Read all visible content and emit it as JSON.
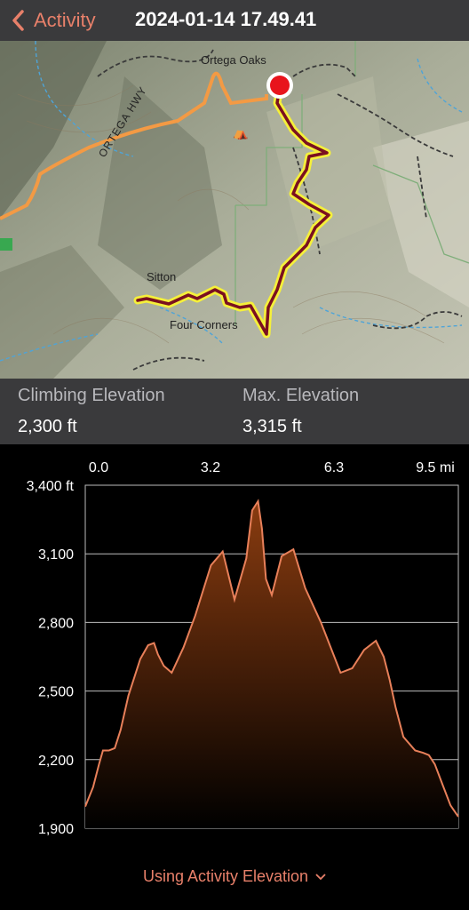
{
  "header": {
    "back_label": "Activity",
    "title": "2024-01-14 17.49.41"
  },
  "map": {
    "labels": {
      "ortega_oaks": "Ortega Oaks",
      "ortega_hwy": "ORTEGA HWY",
      "sitton": "Sitton",
      "four_corners": "Four Corners"
    },
    "route_color": "#7a1020",
    "highlight_color": "#f5f03a",
    "marker_color": "#e8141c"
  },
  "stats": {
    "climbing_label": "Climbing Elevation",
    "climbing_value": "2,300 ft",
    "max_label": "Max. Elevation",
    "max_value": "3,315 ft"
  },
  "chart_data": {
    "type": "area",
    "x_tick_labels": [
      "0.0",
      "3.2",
      "6.3",
      "9.5 mi"
    ],
    "y_tick_labels": [
      "3,400 ft",
      "3,100",
      "2,800",
      "2,500",
      "2,200",
      "1,900"
    ],
    "xlim": [
      0,
      9.5
    ],
    "ylim": [
      1900,
      3400
    ],
    "line_color": "#e8805a",
    "fill_top_color": "#8a3c10",
    "grid": true,
    "x": [
      0.0,
      0.2,
      0.35,
      0.45,
      0.6,
      0.75,
      0.9,
      1.1,
      1.4,
      1.6,
      1.75,
      1.85,
      2.0,
      2.2,
      2.5,
      2.8,
      3.2,
      3.5,
      3.8,
      4.1,
      4.25,
      4.4,
      4.5,
      4.6,
      4.75,
      5.0,
      5.3,
      5.6,
      6.0,
      6.5,
      6.8,
      7.1,
      7.4,
      7.6,
      7.75,
      7.9,
      8.1,
      8.4,
      8.6,
      8.75,
      8.9,
      9.1,
      9.3,
      9.5
    ],
    "y": [
      1995,
      2080,
      2180,
      2240,
      2240,
      2250,
      2330,
      2480,
      2640,
      2700,
      2710,
      2660,
      2610,
      2580,
      2690,
      2830,
      3050,
      3110,
      2900,
      3080,
      3290,
      3330,
      3210,
      2990,
      2920,
      3090,
      3120,
      2950,
      2800,
      2580,
      2600,
      2680,
      2720,
      2650,
      2550,
      2430,
      2300,
      2240,
      2230,
      2220,
      2180,
      2090,
      2000,
      1950
    ]
  },
  "footer": {
    "source_label": "Using Activity Elevation"
  }
}
